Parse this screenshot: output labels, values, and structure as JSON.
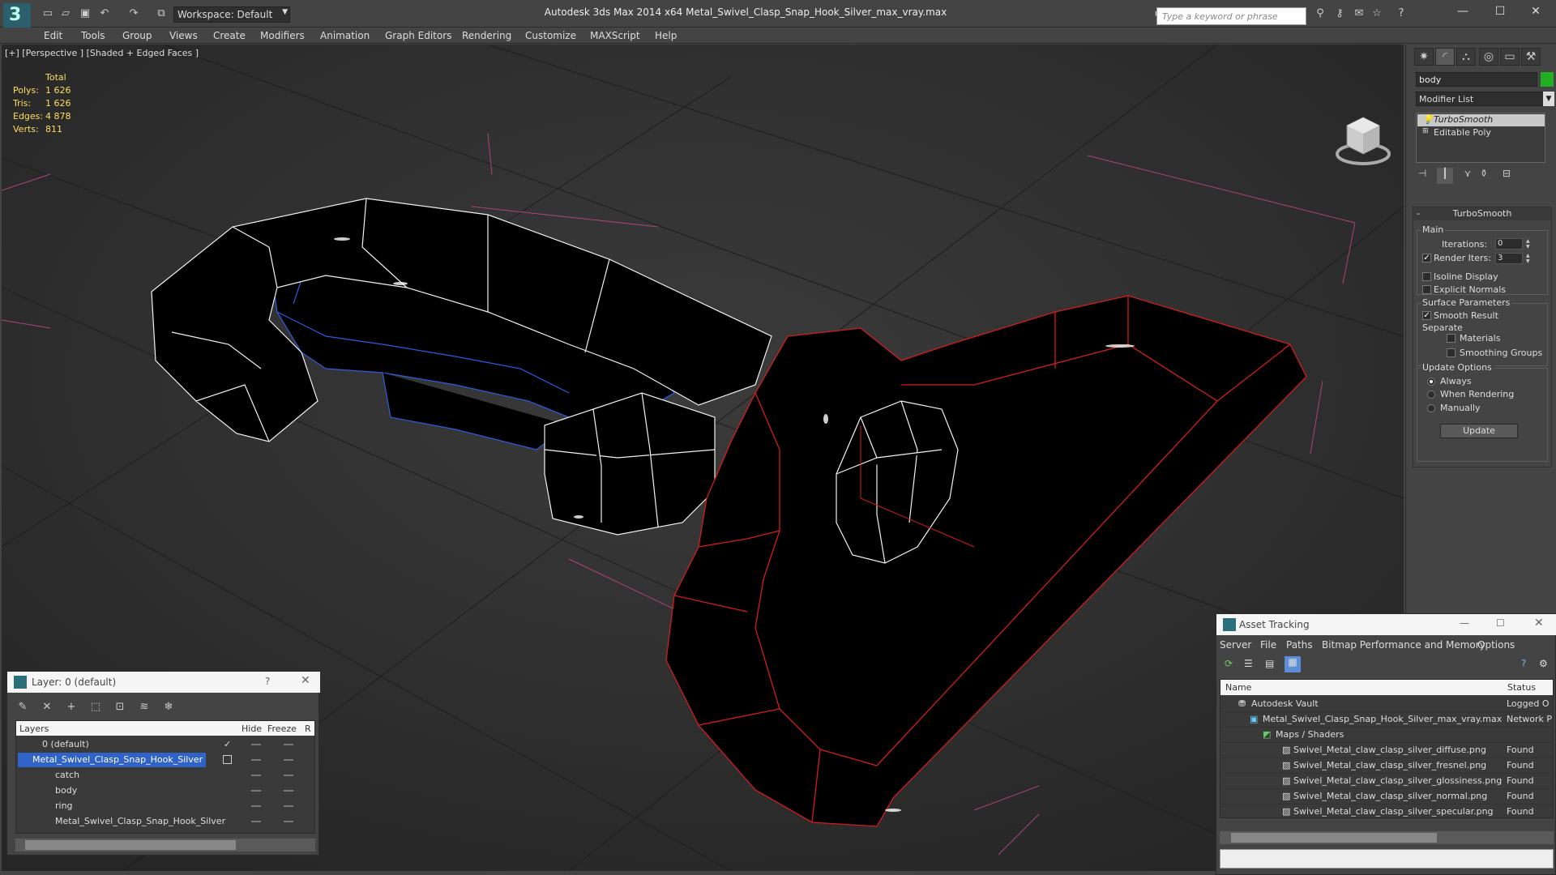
{
  "app": {
    "title": "Autodesk 3ds Max  2014 x64      Metal_Swivel_Clasp_Snap_Hook_Silver_max_vray.max",
    "workspace": "Workspace: Default",
    "search_placeholder": "Type a keyword or phrase"
  },
  "menu": [
    "Edit",
    "Tools",
    "Group",
    "Views",
    "Create",
    "Modifiers",
    "Animation",
    "Graph Editors",
    "Rendering",
    "Customize",
    "MAXScript",
    "Help"
  ],
  "viewport": {
    "label": "[+] [Perspective ] [Shaded + Edged Faces ]",
    "stats_header": "Total",
    "stats": [
      {
        "label": "Polys:",
        "value": "1 626"
      },
      {
        "label": "Tris:",
        "value": "1 626"
      },
      {
        "label": "Edges:",
        "value": "4 878"
      },
      {
        "label": "Verts:",
        "value": "811"
      }
    ]
  },
  "command_panel": {
    "object_name": "body",
    "object_color": "#21b021",
    "modifier_list": "Modifier List",
    "stack": {
      "selected": "TurboSmooth",
      "base": "Editable Poly"
    },
    "rollout": "TurboSmooth",
    "main": {
      "title": "Main",
      "iterations_label": "Iterations:",
      "iterations": "0",
      "render_iters_label": "Render Iters:",
      "render_iters": "3",
      "isoline": "Isoline Display",
      "explicit_normals": "Explicit Normals"
    },
    "surface": {
      "title": "Surface Parameters",
      "smooth_result": "Smooth Result",
      "separate": "Separate",
      "materials": "Materials",
      "smoothing_groups": "Smoothing Groups"
    },
    "update": {
      "title": "Update Options",
      "always": "Always",
      "when_rendering": "When Rendering",
      "manually": "Manually",
      "button": "Update"
    }
  },
  "layer_window": {
    "title": "Layer: 0 (default)",
    "help": "?",
    "columns": [
      "Layers",
      "Hide",
      "Freeze",
      "R"
    ],
    "rows": [
      {
        "name": "0 (default)",
        "indent": 0
      },
      {
        "name": "Metal_Swivel_Clasp_Snap_Hook_Silver",
        "indent": 0
      },
      {
        "name": "catch",
        "indent": 1
      },
      {
        "name": "body",
        "indent": 1
      },
      {
        "name": "ring",
        "indent": 1
      },
      {
        "name": "Metal_Swivel_Clasp_Snap_Hook_Silver",
        "indent": 1
      }
    ]
  },
  "asset_window": {
    "title": "Asset Tracking",
    "menu": [
      "Server",
      "File",
      "Paths",
      "Bitmap Performance and Memory",
      "Options"
    ],
    "columns": [
      "Name",
      "Status"
    ],
    "rows": [
      {
        "name": "Autodesk Vault",
        "status": "Logged O",
        "indent": 1
      },
      {
        "name": "Metal_Swivel_Clasp_Snap_Hook_Silver_max_vray.max",
        "status": "Network P",
        "indent": 2
      },
      {
        "name": "Maps / Shaders",
        "status": "",
        "indent": 3
      },
      {
        "name": "Swivel_Metal_claw_clasp_silver_diffuse.png",
        "status": "Found",
        "indent": 4
      },
      {
        "name": "Swivel_Metal_claw_clasp_silver_fresnel.png",
        "status": "Found",
        "indent": 4
      },
      {
        "name": "Swivel_Metal_claw_clasp_silver_glossiness.png",
        "status": "Found",
        "indent": 4
      },
      {
        "name": "Swivel_Metal_claw_clasp_silver_normal.png",
        "status": "Found",
        "indent": 4
      },
      {
        "name": "Swivel_Metal_claw_clasp_silver_specular.png",
        "status": "Found",
        "indent": 4
      }
    ]
  }
}
